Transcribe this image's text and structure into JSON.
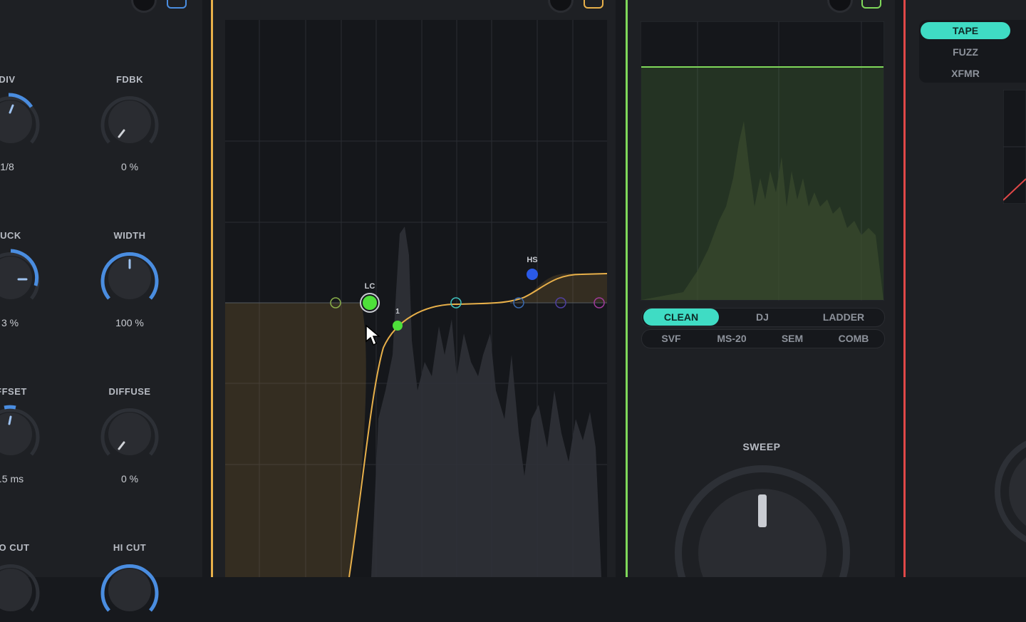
{
  "delay": {
    "params": [
      {
        "label": "DIV",
        "value": "1/8"
      },
      {
        "label": "FDBK",
        "value": "0 %"
      },
      {
        "label": "UCK",
        "value": "3 %"
      },
      {
        "label": "WIDTH",
        "value": "100 %"
      },
      {
        "label": "FFSET",
        "value": ".5 ms"
      },
      {
        "label": "DIFFUSE",
        "value": "0 %"
      },
      {
        "label": "O CUT",
        "value": ""
      },
      {
        "label": "HI CUT",
        "value": ""
      }
    ]
  },
  "eq": {
    "accent": "#e8b04a",
    "bands": {
      "lc": "LC",
      "band1": "1",
      "hs": "HS"
    }
  },
  "sweep": {
    "accent": "#7fd85a",
    "modes_row1": [
      "CLEAN",
      "DJ",
      "LADDER"
    ],
    "modes_row2": [
      "SVF",
      "MS-20",
      "SEM",
      "COMB"
    ],
    "active_mode": "CLEAN",
    "knob_label": "SWEEP"
  },
  "distortion": {
    "accent": "#e04848",
    "modes": [
      "TAPE",
      "FUZZ",
      "XFMR"
    ],
    "active_mode": "TAPE",
    "mode_color": "#3fdcc4"
  }
}
